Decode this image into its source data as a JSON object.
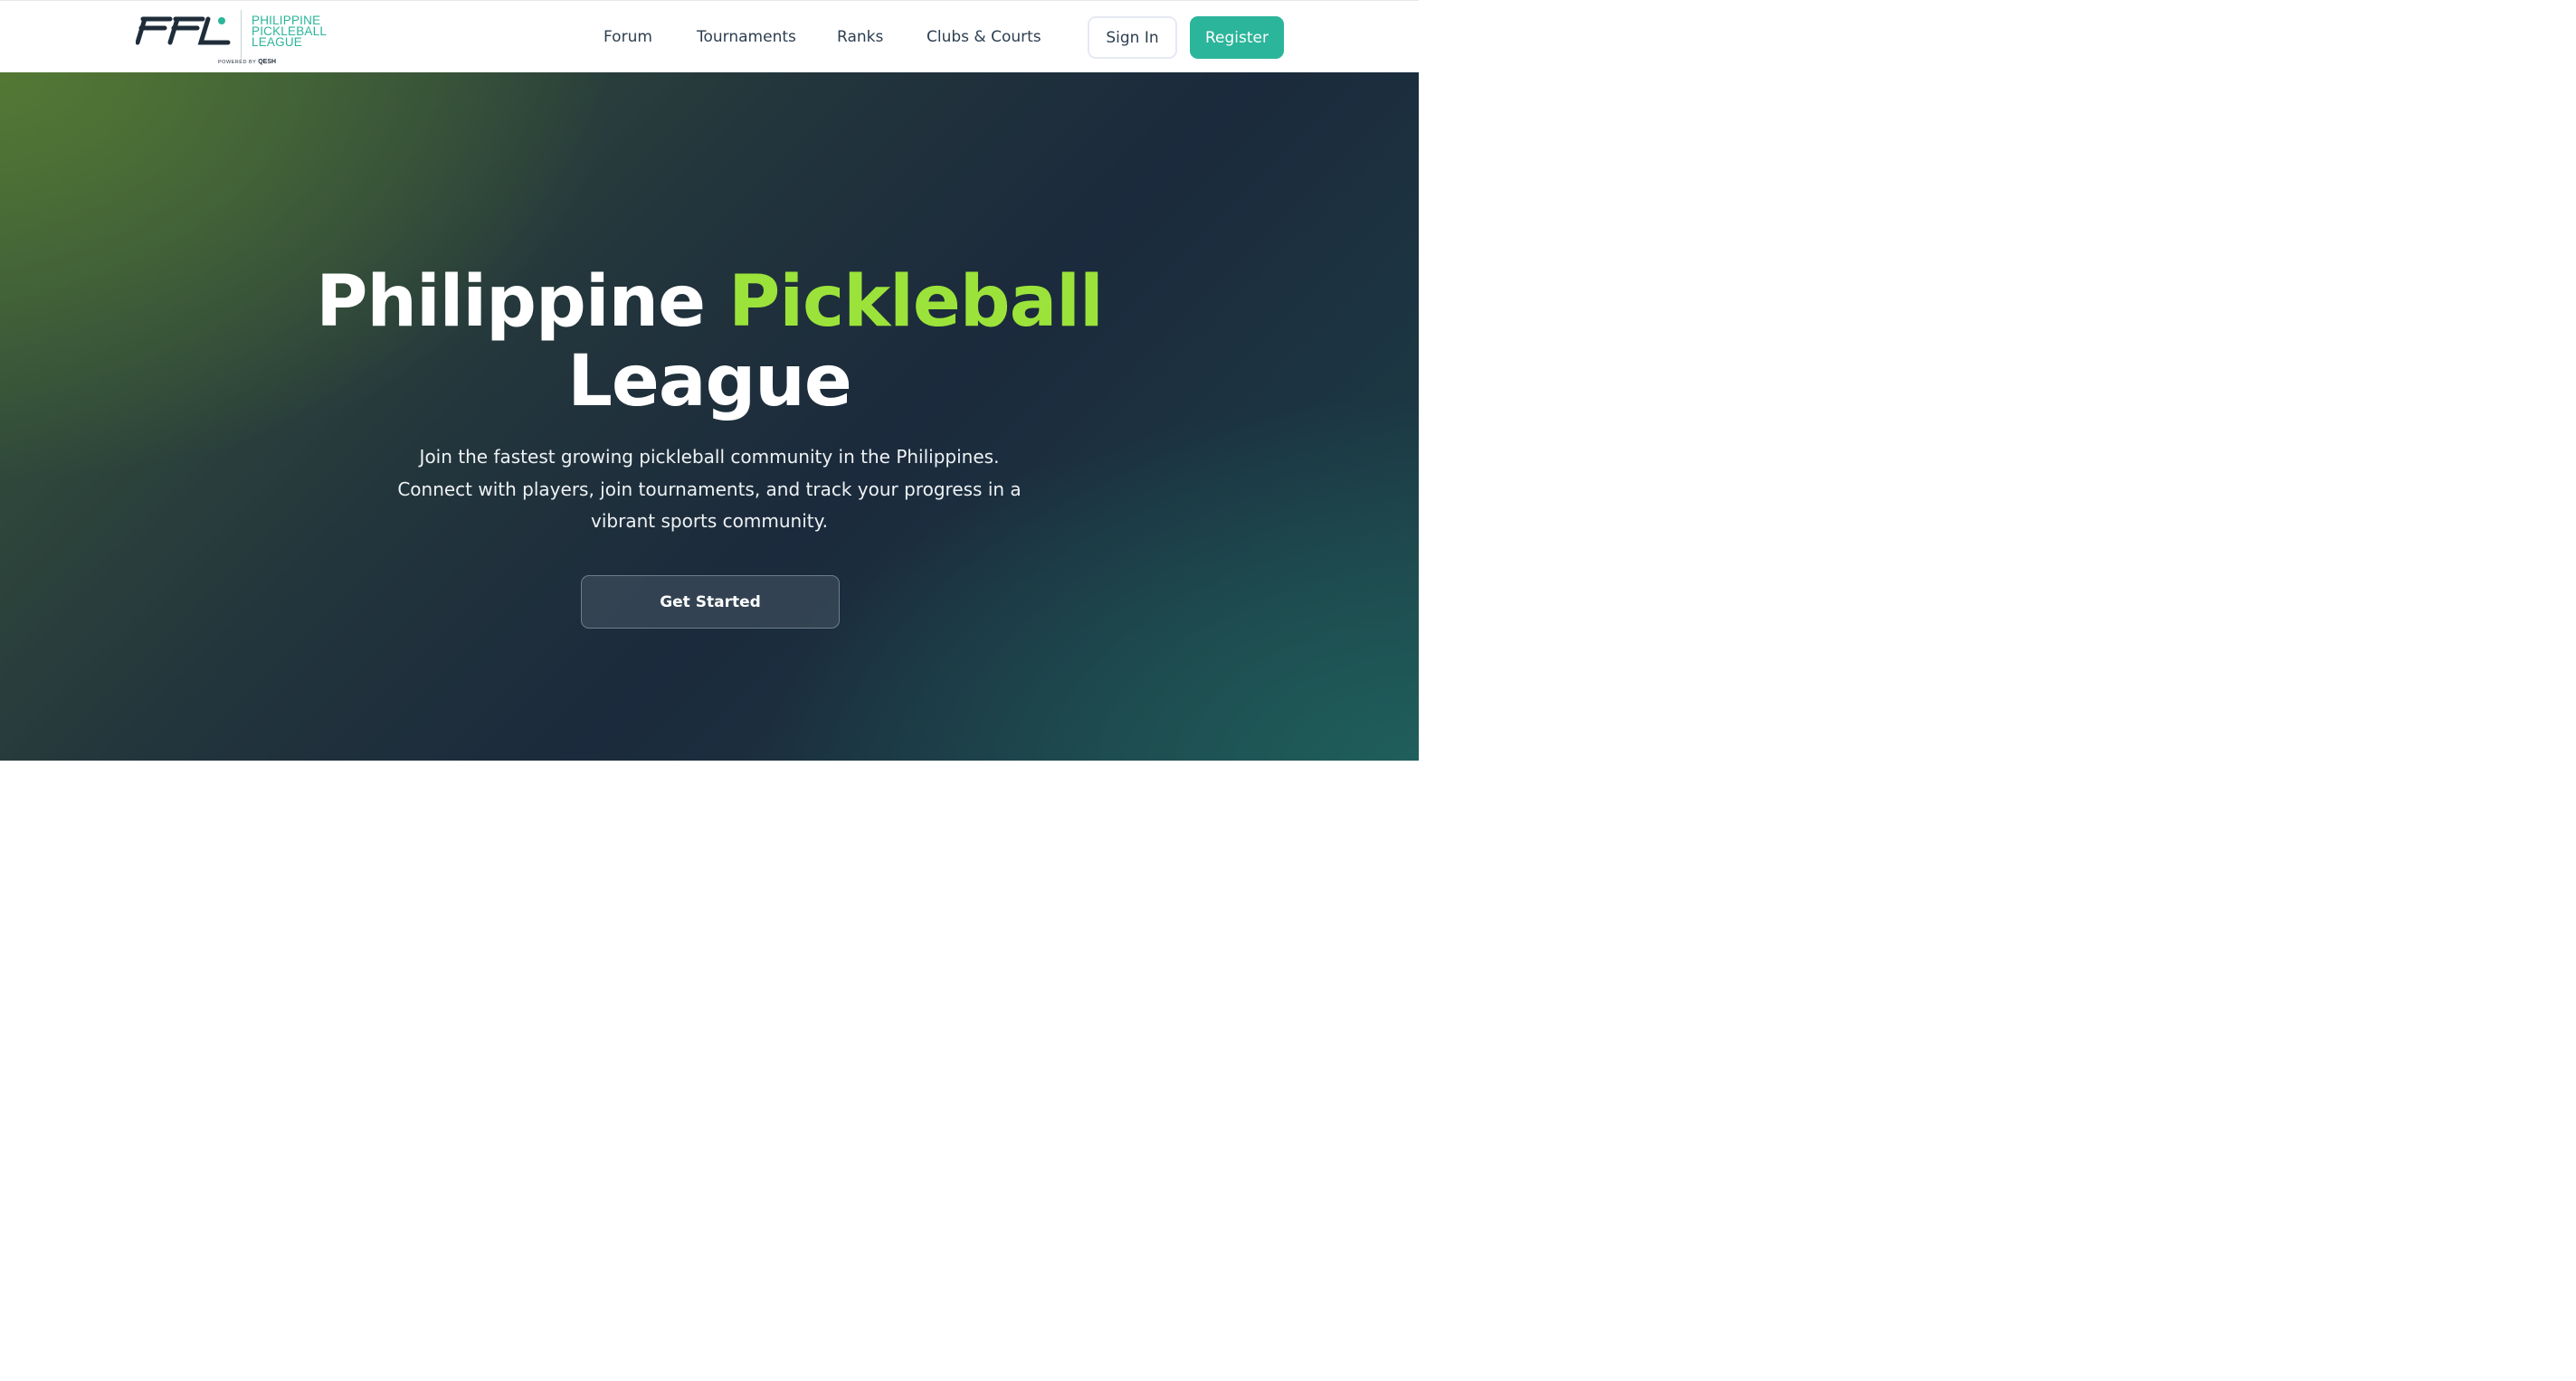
{
  "header": {
    "logo": {
      "text_lines": [
        "PHILIPPINE",
        "PICKLEBALL",
        "LEAGUE"
      ],
      "powered_by": "POWERED BY",
      "powered_brand": "QESH"
    },
    "nav": [
      {
        "label": "Forum"
      },
      {
        "label": "Tournaments"
      },
      {
        "label": "Ranks"
      },
      {
        "label": "Clubs & Courts"
      }
    ],
    "sign_in_label": "Sign In",
    "register_label": "Register"
  },
  "hero": {
    "title_part1": "Philippine",
    "title_accent": "Pickleball",
    "title_part2": "League",
    "subtitle": "Join the fastest growing pickleball community in the Philippines. Connect with players, join tournaments, and track your progress in a vibrant sports community.",
    "cta_label": "Get Started"
  },
  "colors": {
    "brand_teal": "#2bb59a",
    "accent_green": "#9be33a",
    "nav_text": "#2d3e50",
    "logo_navy": "#1f2d3a"
  }
}
